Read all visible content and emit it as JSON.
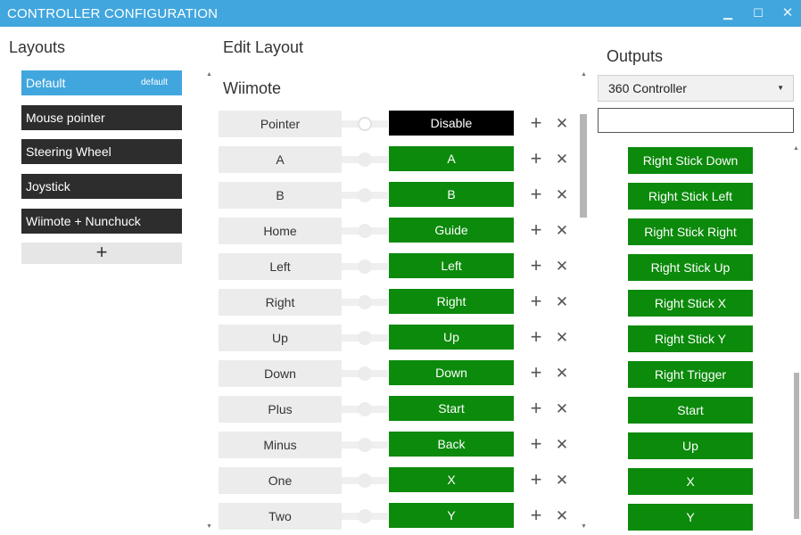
{
  "window": {
    "title": "CONTROLLER CONFIGURATION",
    "minimize_glyph": "▁",
    "maximize_glyph": "☐",
    "close_glyph": "✕"
  },
  "layouts": {
    "heading": "Layouts",
    "items": [
      {
        "label": "Default",
        "badge": "default",
        "active": true
      },
      {
        "label": "Mouse pointer"
      },
      {
        "label": "Steering Wheel"
      },
      {
        "label": "Joystick"
      },
      {
        "label": "Wiimote + Nunchuck"
      }
    ],
    "add_glyph": "+"
  },
  "edit": {
    "heading": "Edit Layout",
    "device": "Wiimote",
    "plus_glyph": "+",
    "remove_glyph": "✕",
    "scroll_up_glyph": "▲",
    "scroll_down_glyph": "▼",
    "rows": [
      {
        "input": "Pointer",
        "output": "Disable"
      },
      {
        "input": "A",
        "output": "A"
      },
      {
        "input": "B",
        "output": "B"
      },
      {
        "input": "Home",
        "output": "Guide"
      },
      {
        "input": "Left",
        "output": "Left"
      },
      {
        "input": "Right",
        "output": "Right"
      },
      {
        "input": "Up",
        "output": "Up"
      },
      {
        "input": "Down",
        "output": "Down"
      },
      {
        "input": "Plus",
        "output": "Start"
      },
      {
        "input": "Minus",
        "output": "Back"
      },
      {
        "input": "One",
        "output": "X"
      },
      {
        "input": "Two",
        "output": "Y"
      }
    ]
  },
  "outputs": {
    "heading": "Outputs",
    "selected_device": "360 Controller",
    "caret_glyph": "▼",
    "filter_value": "",
    "scroll_up_glyph": "▲",
    "items": [
      "Right Stick Down",
      "Right Stick Left",
      "Right Stick Right",
      "Right Stick Up",
      "Right Stick X",
      "Right Stick Y",
      "Right Trigger",
      "Start",
      "Up",
      "X",
      "Y"
    ]
  },
  "colors": {
    "accent": "#41a6de",
    "mapped_output": "#0b8a0b",
    "disabled_output": "#000000",
    "layout_item": "#2d2d2d"
  }
}
